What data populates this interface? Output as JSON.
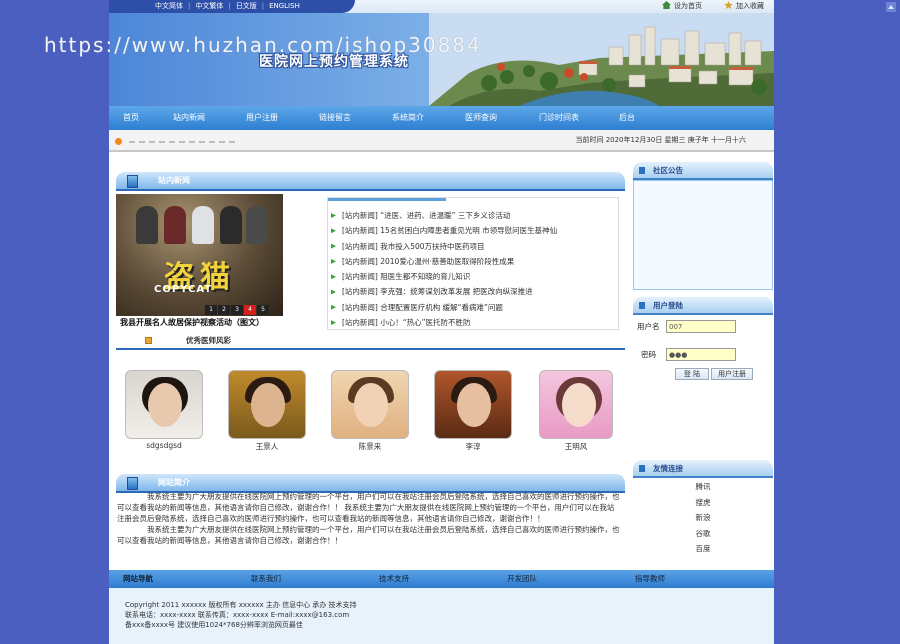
{
  "watermark": "https://www.huzhan.com/ishop30884",
  "lang_links": [
    "中文简体",
    "中文繁体",
    "日文版",
    "ENGLISH"
  ],
  "top_links": {
    "home": "设为首页",
    "favorite": "加入收藏"
  },
  "site_title": "医院网上预约管理系统",
  "nav": [
    "首页",
    "站内新闻",
    "用户注册",
    "链接留言",
    "系统简介",
    "医师查询",
    "门诊时间表",
    "后台"
  ],
  "info_bar": {
    "date_text": "当前时间  2020年12月30日  星期三  庚子年  十一月十六"
  },
  "news": {
    "title": "站内新闻",
    "photo_logo": "盗猫",
    "photo_sub": "COPYCAT",
    "slider_pages": [
      "1",
      "2",
      "3",
      "4",
      "5"
    ],
    "slider_active": 4,
    "caption": "我县开展名人故居保护视察活动（图文）",
    "items": [
      "[站内新闻]  “进医、进药、进温暖” 三下乡义诊活动",
      "[站内新闻]  15名贫困白内障患者重见光明  市领导慰问医生基神仙",
      "[站内新闻]  我市投入500万扶持中医药项目",
      "[站内新闻]  2010爱心温州·慈善助医取得阶段性成果",
      "[站内新闻]  阻医生都不知晓的育儿知识",
      "[站内新闻]  李克强：统筹谋划改革发展  把医改向纵深推进",
      "[站内新闻]  合理配置医疗机构  缓解“看病难”问题",
      "[站内新闻]  小心！“热心”医托防不胜防"
    ]
  },
  "doctors": {
    "tab_label": "优秀医师风彩",
    "items": [
      {
        "name": "sdgsdgsd"
      },
      {
        "name": "王景人"
      },
      {
        "name": "陈景来"
      },
      {
        "name": "李淳"
      },
      {
        "name": "王明风"
      }
    ]
  },
  "intro": {
    "title": "网站简介",
    "paragraphs": [
      "我系统主要为广大朋友提供在线医院网上预约管理的一个平台，用户们可以在我站注册会员后登陆系统，选择自己喜欢的医师进行预约操作，也可以查看我站的新闻等信息，其他语言请你自己修改，谢谢合作！！      我系统主要为广大朋友提供在线医院网上预约管理的一个平台，用户们可以在我站注册会员后登陆系统，选择自己喜欢的医师进行预约操作，也可以查看我站的新闻等信息，其他语言请你自己修改，谢谢合作！！",
      "我系统主要为广大朋友提供在线医院网上预约管理的一个平台，用户们可以在我站注册会员后登陆系统，选择自己喜欢的医师进行预约操作，也可以查看我站的新闻等信息，其他语言请你自己修改，谢谢合作！！"
    ]
  },
  "sidebar": {
    "notice_title": "社区公告",
    "login": {
      "title": "用户登陆",
      "username_label": "用户名",
      "username_value": "007",
      "password_label": "密码",
      "password_value": "●●●",
      "login_button": "登 陆",
      "register_button": "用户注册"
    },
    "links_title": "友情连接",
    "links": [
      "腾讯",
      "搜虎",
      "新浪",
      "谷歌",
      "百度"
    ]
  },
  "footer_nav": [
    "网站导航",
    "联系我们",
    "技术支持",
    "开发团队",
    "指导教师"
  ],
  "footer_lines": [
    "Copyright 2011 xxxxxx 版权所有 xxxxxx 主办 信息中心 承办 技术支持",
    "联系电话：xxxx-xxxx  联系传真：xxxx-xxxx  E-mail:xxxx@163.com",
    "备xxx备xxxx号  建议使用1024*768分辨率浏览网页最佳"
  ],
  "colors": {
    "outer_bg": "#4a5fc0",
    "nav_blue": "#2e7fd2",
    "accent_orange": "#f08a1d"
  }
}
